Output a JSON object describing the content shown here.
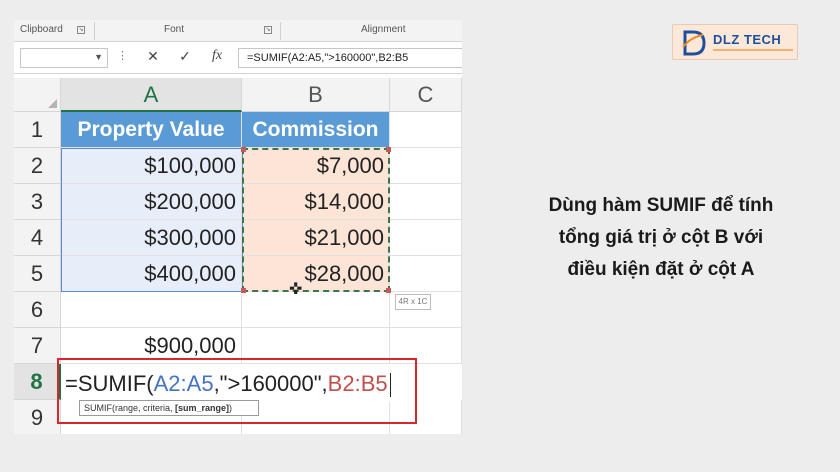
{
  "ribbon": {
    "groups": [
      "Clipboard",
      "Font",
      "Alignment"
    ]
  },
  "formula_bar": {
    "name_box_value": "",
    "cancel_glyph": "✕",
    "enter_glyph": "✓",
    "fx_label": "fx",
    "formula_text": "=SUMIF(A2:A5,\">160000\",B2:B5"
  },
  "columns": [
    "A",
    "B",
    "C"
  ],
  "rows": [
    "1",
    "2",
    "3",
    "4",
    "5",
    "6",
    "7",
    "8",
    "9"
  ],
  "table": {
    "headers": [
      "Property Value",
      "Commission"
    ],
    "property_values": [
      "$100,000",
      "$200,000",
      "$300,000",
      "$400,000"
    ],
    "commissions": [
      "$7,000",
      "$14,000",
      "$21,000",
      "$28,000"
    ]
  },
  "cell_a7": "$900,000",
  "editor": {
    "prefix": "=SUMIF(",
    "ref_a": "A2:A5",
    "middle": ",\">160000\",",
    "ref_b": "B2:B5"
  },
  "selection_size_tip": "4R x 1C",
  "tooltip": {
    "signature": "SUMIF(range, criteria, ",
    "active_arg": "[sum_range]",
    "close": ")"
  },
  "logo": {
    "text": "DLZ TECH"
  },
  "caption": {
    "line1": "Dùng hàm SUMIF để tính",
    "line2": "tổng giá trị ở cột B với",
    "line3": "điều kiện đặt ở cột A"
  },
  "colors": {
    "header_fill": "#5b9bd5",
    "range_a": "#4472c4",
    "range_b": "#c0504d",
    "excel_green": "#217346",
    "highlight_box": "#d6282c"
  }
}
